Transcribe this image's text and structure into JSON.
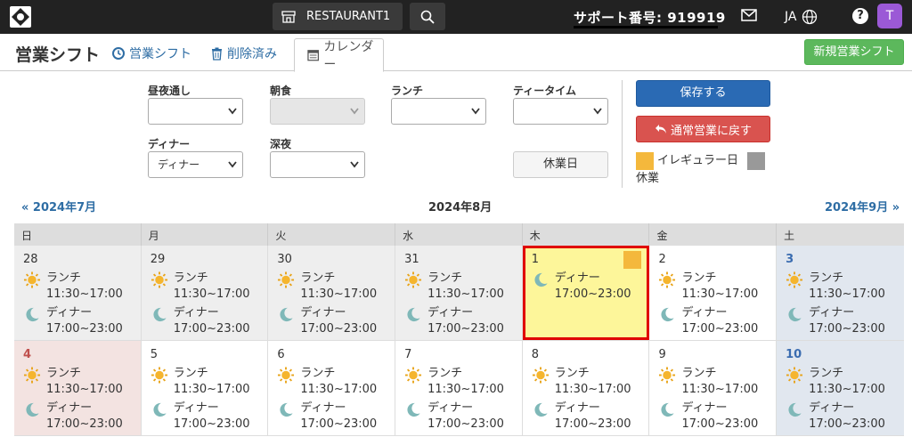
{
  "topbar": {
    "store_label": "RESTAURANT1",
    "support_text": "サポート番号: 919919",
    "lang": "JA",
    "help": "?",
    "avatar": "T"
  },
  "header": {
    "title": "営業シフト",
    "tabs": [
      {
        "label": "営業シフト",
        "icon": "clock-icon"
      },
      {
        "label": "削除済み",
        "icon": "trash-icon"
      },
      {
        "label": "カレンダー",
        "icon": "calendar-icon"
      }
    ],
    "new_button": "新規営業シフト"
  },
  "filters": {
    "allday": {
      "label": "昼夜通し",
      "value": ""
    },
    "morning": {
      "label": "朝食",
      "value": ""
    },
    "lunch": {
      "label": "ランチ",
      "value": ""
    },
    "tea": {
      "label": "ティータイム",
      "value": ""
    },
    "dinner": {
      "label": "ディナー",
      "value": "ディナー"
    },
    "late": {
      "label": "深夜",
      "value": ""
    },
    "holiday_button": "休業日"
  },
  "actions": {
    "save": "保存する",
    "revert": "通常営業に戻す",
    "legend_irregular": "イレギュラー日",
    "legend_closed": "休業",
    "colors": {
      "irregular": "#f4b83c",
      "closed": "#999999"
    }
  },
  "nav": {
    "prev": "« 2024年7月",
    "current": "2024年8月",
    "next": "2024年9月 »"
  },
  "calendar": {
    "weekdays": [
      "日",
      "月",
      "火",
      "水",
      "木",
      "金",
      "土"
    ],
    "shifts": {
      "lunch": {
        "name": "ランチ",
        "time": "11:30~17:00"
      },
      "dinner": {
        "name": "ディナー",
        "time": "17:00~23:00"
      }
    },
    "weeks": [
      [
        "28",
        "29",
        "30",
        "31",
        "1",
        "2",
        "3"
      ],
      [
        "4",
        "5",
        "6",
        "7",
        "8",
        "9",
        "10"
      ]
    ]
  }
}
